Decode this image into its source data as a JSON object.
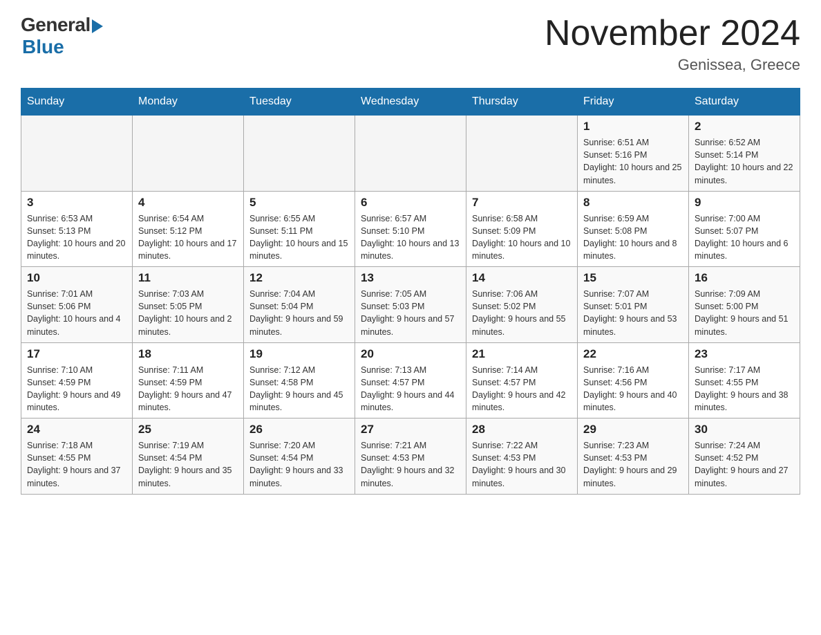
{
  "logo": {
    "general": "General",
    "blue": "Blue"
  },
  "title": "November 2024",
  "subtitle": "Genissea, Greece",
  "weekdays": [
    "Sunday",
    "Monday",
    "Tuesday",
    "Wednesday",
    "Thursday",
    "Friday",
    "Saturday"
  ],
  "weeks": [
    [
      {
        "day": "",
        "info": ""
      },
      {
        "day": "",
        "info": ""
      },
      {
        "day": "",
        "info": ""
      },
      {
        "day": "",
        "info": ""
      },
      {
        "day": "",
        "info": ""
      },
      {
        "day": "1",
        "info": "Sunrise: 6:51 AM\nSunset: 5:16 PM\nDaylight: 10 hours and 25 minutes."
      },
      {
        "day": "2",
        "info": "Sunrise: 6:52 AM\nSunset: 5:14 PM\nDaylight: 10 hours and 22 minutes."
      }
    ],
    [
      {
        "day": "3",
        "info": "Sunrise: 6:53 AM\nSunset: 5:13 PM\nDaylight: 10 hours and 20 minutes."
      },
      {
        "day": "4",
        "info": "Sunrise: 6:54 AM\nSunset: 5:12 PM\nDaylight: 10 hours and 17 minutes."
      },
      {
        "day": "5",
        "info": "Sunrise: 6:55 AM\nSunset: 5:11 PM\nDaylight: 10 hours and 15 minutes."
      },
      {
        "day": "6",
        "info": "Sunrise: 6:57 AM\nSunset: 5:10 PM\nDaylight: 10 hours and 13 minutes."
      },
      {
        "day": "7",
        "info": "Sunrise: 6:58 AM\nSunset: 5:09 PM\nDaylight: 10 hours and 10 minutes."
      },
      {
        "day": "8",
        "info": "Sunrise: 6:59 AM\nSunset: 5:08 PM\nDaylight: 10 hours and 8 minutes."
      },
      {
        "day": "9",
        "info": "Sunrise: 7:00 AM\nSunset: 5:07 PM\nDaylight: 10 hours and 6 minutes."
      }
    ],
    [
      {
        "day": "10",
        "info": "Sunrise: 7:01 AM\nSunset: 5:06 PM\nDaylight: 10 hours and 4 minutes."
      },
      {
        "day": "11",
        "info": "Sunrise: 7:03 AM\nSunset: 5:05 PM\nDaylight: 10 hours and 2 minutes."
      },
      {
        "day": "12",
        "info": "Sunrise: 7:04 AM\nSunset: 5:04 PM\nDaylight: 9 hours and 59 minutes."
      },
      {
        "day": "13",
        "info": "Sunrise: 7:05 AM\nSunset: 5:03 PM\nDaylight: 9 hours and 57 minutes."
      },
      {
        "day": "14",
        "info": "Sunrise: 7:06 AM\nSunset: 5:02 PM\nDaylight: 9 hours and 55 minutes."
      },
      {
        "day": "15",
        "info": "Sunrise: 7:07 AM\nSunset: 5:01 PM\nDaylight: 9 hours and 53 minutes."
      },
      {
        "day": "16",
        "info": "Sunrise: 7:09 AM\nSunset: 5:00 PM\nDaylight: 9 hours and 51 minutes."
      }
    ],
    [
      {
        "day": "17",
        "info": "Sunrise: 7:10 AM\nSunset: 4:59 PM\nDaylight: 9 hours and 49 minutes."
      },
      {
        "day": "18",
        "info": "Sunrise: 7:11 AM\nSunset: 4:59 PM\nDaylight: 9 hours and 47 minutes."
      },
      {
        "day": "19",
        "info": "Sunrise: 7:12 AM\nSunset: 4:58 PM\nDaylight: 9 hours and 45 minutes."
      },
      {
        "day": "20",
        "info": "Sunrise: 7:13 AM\nSunset: 4:57 PM\nDaylight: 9 hours and 44 minutes."
      },
      {
        "day": "21",
        "info": "Sunrise: 7:14 AM\nSunset: 4:57 PM\nDaylight: 9 hours and 42 minutes."
      },
      {
        "day": "22",
        "info": "Sunrise: 7:16 AM\nSunset: 4:56 PM\nDaylight: 9 hours and 40 minutes."
      },
      {
        "day": "23",
        "info": "Sunrise: 7:17 AM\nSunset: 4:55 PM\nDaylight: 9 hours and 38 minutes."
      }
    ],
    [
      {
        "day": "24",
        "info": "Sunrise: 7:18 AM\nSunset: 4:55 PM\nDaylight: 9 hours and 37 minutes."
      },
      {
        "day": "25",
        "info": "Sunrise: 7:19 AM\nSunset: 4:54 PM\nDaylight: 9 hours and 35 minutes."
      },
      {
        "day": "26",
        "info": "Sunrise: 7:20 AM\nSunset: 4:54 PM\nDaylight: 9 hours and 33 minutes."
      },
      {
        "day": "27",
        "info": "Sunrise: 7:21 AM\nSunset: 4:53 PM\nDaylight: 9 hours and 32 minutes."
      },
      {
        "day": "28",
        "info": "Sunrise: 7:22 AM\nSunset: 4:53 PM\nDaylight: 9 hours and 30 minutes."
      },
      {
        "day": "29",
        "info": "Sunrise: 7:23 AM\nSunset: 4:53 PM\nDaylight: 9 hours and 29 minutes."
      },
      {
        "day": "30",
        "info": "Sunrise: 7:24 AM\nSunset: 4:52 PM\nDaylight: 9 hours and 27 minutes."
      }
    ]
  ]
}
